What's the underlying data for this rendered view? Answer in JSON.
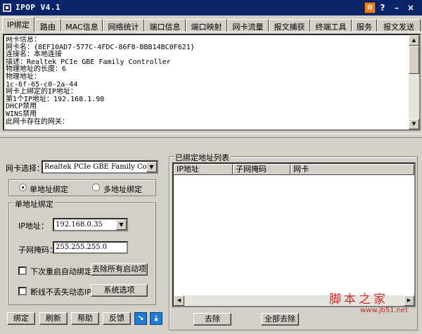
{
  "window": {
    "title": "IPOP V4.1",
    "menu_button": "⊞",
    "help_button": "?",
    "minimize_button": "–",
    "close_button": "×"
  },
  "tabs": [
    "IP绑定",
    "路由",
    "MAC信息",
    "网络统计",
    "端口信息",
    "端口映射",
    "网卡流量",
    "报文捕获",
    "终端工具",
    "服务",
    "报文发送"
  ],
  "active_tab": "IP绑定",
  "info_text": "网卡信息：\n网卡名：{8EF10AD7-577C-4FDC-86F8-BBB14BC0F621}\n连接名：本地连接\n描述：Realtek PCIe GBE Family Controller\n物理地址的长度：6\n物理地址：\n1c-6f-65-c0-2a-44\n网卡上绑定的IP地址：\n第1个IP地址：192.168.1.98\nDHCP禁用\nWINS禁用\n此网卡存在的网关：",
  "left": {
    "nic_label": "网卡选择：",
    "nic_value": "Realtek PCIe GBE Family Contr",
    "radio_single": "单地址绑定",
    "radio_multi": "多地址绑定",
    "group_title": "单地址绑定",
    "ip_label": "IP地址：",
    "ip_value": "192.168.0.35",
    "mask_label": "子网掩码：",
    "mask_value": "255.255.255.0",
    "auto_bind_label": "下次重启自动绑定",
    "clear_startup_button": "去除所有启动项",
    "keep_dynamic_label": "断线不丢失动态IP",
    "system_options_button": "系统选项",
    "bind_button": "绑定",
    "refresh_button": "刷新",
    "help_button": "帮助",
    "feedback_button": "反馈"
  },
  "right": {
    "group_title": "已绑定地址列表",
    "col_ip": "IP地址",
    "col_mask": "子网掩码",
    "col_nic": "网卡",
    "remove_button": "去除",
    "remove_all_button": "全部去除"
  },
  "watermark": {
    "text": "脚本之家",
    "url": "www.jb51.net"
  }
}
